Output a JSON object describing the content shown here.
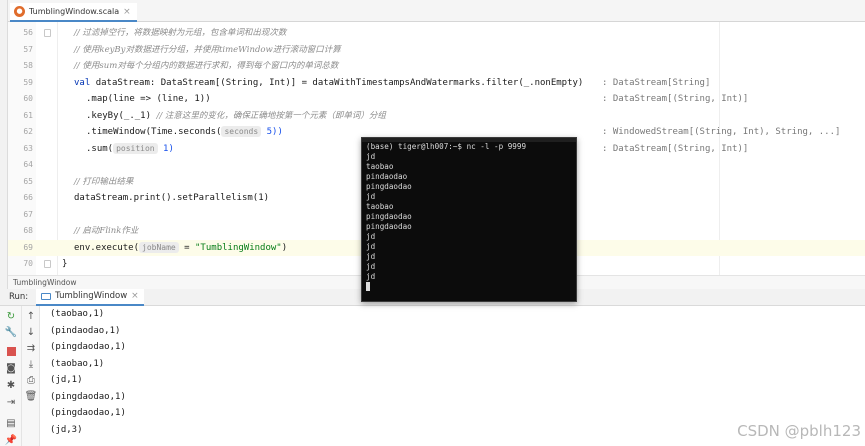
{
  "editor_tab": {
    "icon": "scala-icon",
    "filename": "TumblingWindow.scala",
    "close": "×"
  },
  "editor": {
    "lines": [
      {
        "num": "56",
        "text": "// 过滤掉空行，将数据映射为元组，包含单词和出现次数",
        "kind": "comment"
      },
      {
        "num": "57",
        "text": "// 使用keyBy对数据进行分组，并使用timeWindow进行滚动窗口计算",
        "kind": "comment"
      },
      {
        "num": "58",
        "text": "// 使用sum对每个分组内的数据进行求和，得到每个窗口内的单词总数",
        "kind": "comment"
      },
      {
        "num": "59",
        "kind": "code"
      },
      {
        "num": "60",
        "kind": "code"
      },
      {
        "num": "61",
        "kind": "code"
      },
      {
        "num": "62",
        "kind": "code"
      },
      {
        "num": "63",
        "kind": "code"
      },
      {
        "num": "64",
        "kind": "blank"
      },
      {
        "num": "65",
        "text": "// 打印输出结果",
        "kind": "comment"
      },
      {
        "num": "66",
        "kind": "code"
      },
      {
        "num": "67",
        "kind": "blank"
      },
      {
        "num": "68",
        "text": "// 启动Flink作业",
        "kind": "comment"
      },
      {
        "num": "69",
        "kind": "code"
      },
      {
        "num": "70",
        "kind": "code"
      }
    ],
    "code": {
      "l59_val": "val ",
      "l59_a": "dataStream: DataStream[(String, Int)] = dataWithTimestampsAndWatermarks.filter(_.nonEmpty)",
      "l60": ".map(line => (line, 1))",
      "l61_a": ".keyBy(_._1) ",
      "l61_comment": "// 注意这里的变化，确保正确地按第一个元素（即单词）分组",
      "l62_a": ".timeWindow(Time.seconds(",
      "l62_hint": "seconds",
      "l62_b": "5))",
      "l63_a": ".sum(",
      "l63_hint": "position",
      "l63_b": "1)",
      "l66": "dataStream.print().setParallelism(1)",
      "l69_a": "env.execute(",
      "l69_hint": "jobName",
      "l69_str": "\"TumblingWindow\"",
      "l69_b": ")",
      "l70": "}"
    },
    "type_hints": [
      ": DataStream[String]",
      ": DataStream[(String, Int)]",
      ": WindowedStream[(String, Int), String, ...]",
      ": DataStream[(String, Int)]"
    ]
  },
  "breadcrumb": "TumblingWindow",
  "run_panel": {
    "title": "Run:",
    "tab_label": "TumblingWindow",
    "tab_close": "×",
    "output": [
      "(taobao,1)",
      "(pindaodao,1)",
      "(pingdaodao,1)",
      "(taobao,1)",
      "(jd,1)",
      "(pingdaodao,1)",
      "(pingdaodao,1)",
      "(jd,3)"
    ]
  },
  "terminal": {
    "prompt": "(base) tiger@lh007:~$ nc -l -p 9999",
    "lines": [
      "jd",
      "taobao",
      "pindaodao",
      "pingdaodao",
      "jd",
      "taobao",
      "pingdaodao",
      "pingdaodao",
      "jd",
      "jd",
      "jd",
      "jd",
      "jd"
    ]
  },
  "watermark": "CSDN @pblh123",
  "colors": {
    "accent": "#4a88c7",
    "terminal_bg": "#0c0c0c",
    "comment": "#8c8c8c"
  }
}
